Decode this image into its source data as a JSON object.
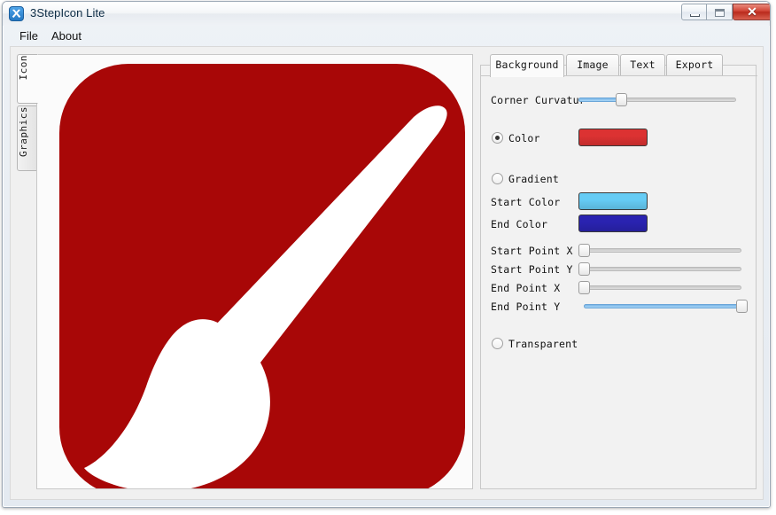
{
  "window": {
    "title": "3StepIcon Lite",
    "icon": "app-brushes-icon",
    "controls": {
      "minimize": "minimize-icon",
      "maximize": "maximize-icon",
      "close_label": "✕"
    }
  },
  "menubar": {
    "items": [
      {
        "label": "File"
      },
      {
        "label": "About"
      }
    ]
  },
  "vertical_tabs": {
    "items": [
      {
        "label": "Icon",
        "selected": true
      },
      {
        "label": "Graphics",
        "selected": false
      }
    ]
  },
  "canvas": {
    "name": "icon-preview",
    "background_color": "#A80707",
    "shape_color": "#FFFFFF",
    "corner_radius_px": 78
  },
  "properties": {
    "tabs": [
      {
        "label": "Background",
        "selected": true
      },
      {
        "label": "Image",
        "selected": false
      },
      {
        "label": "Text",
        "selected": false
      },
      {
        "label": "Export",
        "selected": false
      }
    ],
    "corner_curvature": {
      "label": "Corner Curvatur",
      "value_percent": 27
    },
    "fill_mode": {
      "color": {
        "label": "Color",
        "selected": true,
        "swatch_color": "#DC3232"
      },
      "gradient": {
        "label": "Gradient",
        "selected": false
      },
      "transparent": {
        "label": "Transparent",
        "selected": false
      }
    },
    "gradient": {
      "start_color": {
        "label": "Start Color",
        "swatch_color": "#66CCF5"
      },
      "end_color": {
        "label": "End Color",
        "swatch_color": "#2A23B0"
      },
      "sliders": [
        {
          "label": "Start Point X",
          "value_percent": 0
        },
        {
          "label": "Start Point Y",
          "value_percent": 0
        },
        {
          "label": "End Point X",
          "value_percent": 0
        },
        {
          "label": "End Point Y",
          "value_percent": 100
        }
      ]
    }
  }
}
